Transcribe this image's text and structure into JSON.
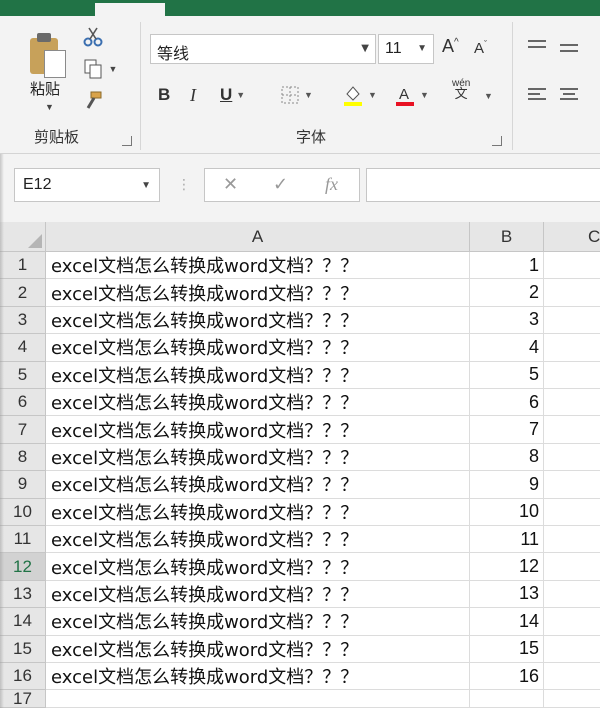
{
  "ribbon": {
    "clipboard": {
      "paste_label": "粘贴",
      "group_label": "剪贴板"
    },
    "font": {
      "font_name": "等线",
      "font_size": "11",
      "group_label": "字体",
      "bold": "B",
      "italic": "I",
      "underline": "U",
      "grow": "A",
      "shrink": "A",
      "phonetic_top": "wén",
      "phonetic_bottom": "文"
    }
  },
  "formula_bar": {
    "name_box": "E12",
    "cancel": "✕",
    "enter": "✓",
    "fx": "fx",
    "formula": ""
  },
  "sheet": {
    "columns": [
      "A",
      "B",
      "C"
    ],
    "selected_row": "12",
    "rows": [
      {
        "num": "1",
        "a": "excel文档怎么转换成word文档？？？",
        "b": "1"
      },
      {
        "num": "2",
        "a": "excel文档怎么转换成word文档？？？",
        "b": "2"
      },
      {
        "num": "3",
        "a": "excel文档怎么转换成word文档？？？",
        "b": "3"
      },
      {
        "num": "4",
        "a": "excel文档怎么转换成word文档？？？",
        "b": "4"
      },
      {
        "num": "5",
        "a": "excel文档怎么转换成word文档？？？",
        "b": "5"
      },
      {
        "num": "6",
        "a": "excel文档怎么转换成word文档？？？",
        "b": "6"
      },
      {
        "num": "7",
        "a": "excel文档怎么转换成word文档？？？",
        "b": "7"
      },
      {
        "num": "8",
        "a": "excel文档怎么转换成word文档？？？",
        "b": "8"
      },
      {
        "num": "9",
        "a": "excel文档怎么转换成word文档？？？",
        "b": "9"
      },
      {
        "num": "10",
        "a": "excel文档怎么转换成word文档？？？",
        "b": "10"
      },
      {
        "num": "11",
        "a": "excel文档怎么转换成word文档？？？",
        "b": "11"
      },
      {
        "num": "12",
        "a": "excel文档怎么转换成word文档？？？",
        "b": "12"
      },
      {
        "num": "13",
        "a": "excel文档怎么转换成word文档？？？",
        "b": "13"
      },
      {
        "num": "14",
        "a": "excel文档怎么转换成word文档？？？",
        "b": "14"
      },
      {
        "num": "15",
        "a": "excel文档怎么转换成word文档？？？",
        "b": "15"
      },
      {
        "num": "16",
        "a": "excel文档怎么转换成word文档？？？",
        "b": "16"
      },
      {
        "num": "17",
        "a": "",
        "b": ""
      }
    ]
  },
  "colors": {
    "brand": "#217346",
    "font_color": "#e81123",
    "highlight": "#ffff00"
  }
}
